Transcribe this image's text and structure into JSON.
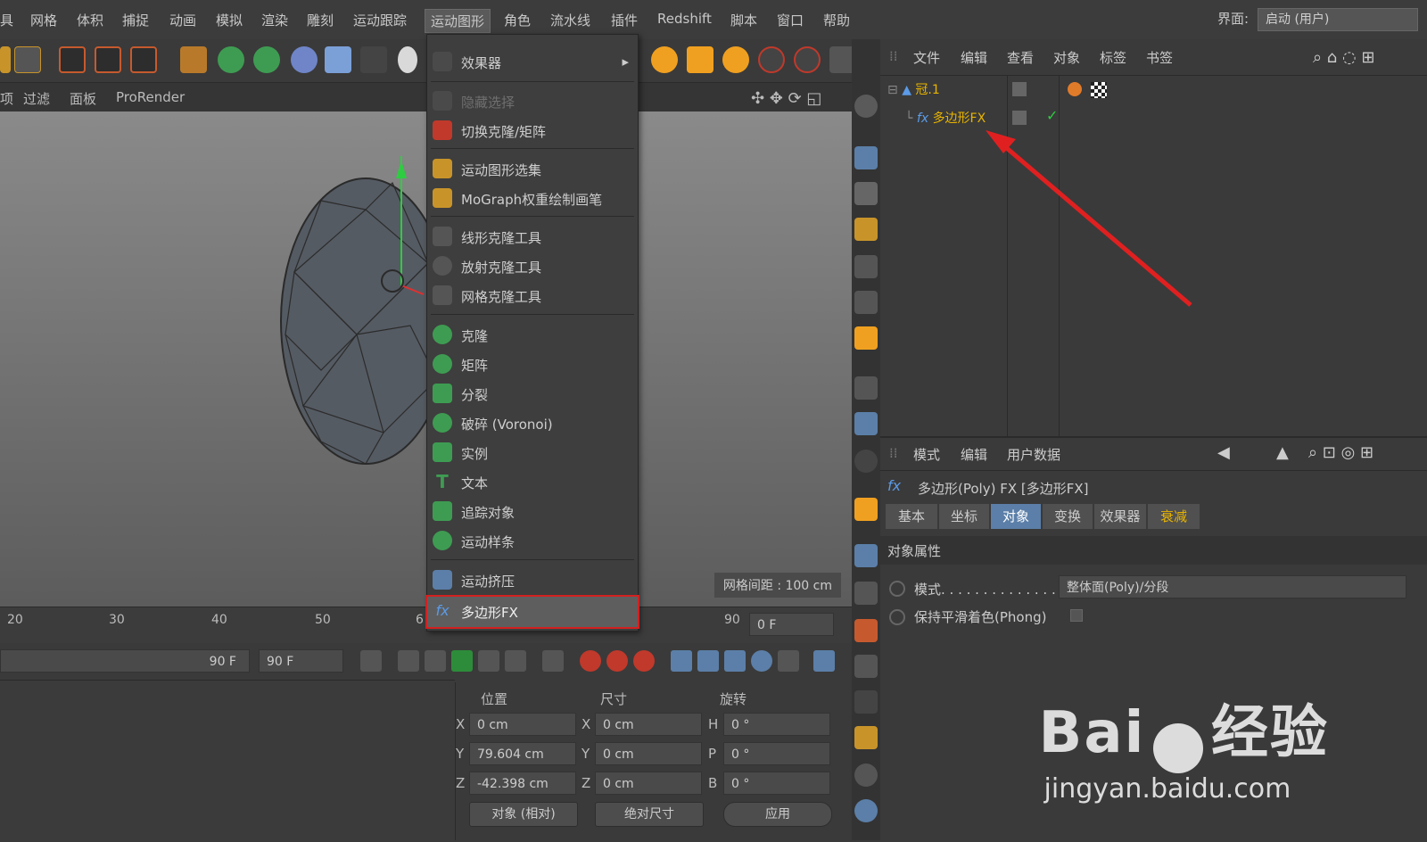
{
  "menubar": {
    "items": [
      "具",
      "网格",
      "体积",
      "捕捉",
      "动画",
      "模拟",
      "渲染",
      "雕刻",
      "运动跟踪",
      "运动图形",
      "角色",
      "流水线",
      "插件",
      "Redshift",
      "脚本",
      "窗口",
      "帮助"
    ],
    "active_index": 9,
    "interface_label": "界面:",
    "interface_value": "启动 (用户)"
  },
  "viewport_bar": {
    "items": [
      "项",
      "过滤",
      "面板",
      "ProRender"
    ]
  },
  "viewport": {
    "grid_spacing": "网格间距 : 100 cm"
  },
  "timeline": {
    "ticks": [
      "20",
      "30",
      "40",
      "50",
      "6",
      "90"
    ],
    "frame_field": "0 F"
  },
  "playbar": {
    "end_frame_slider": "90 F",
    "end_frame_field": "90 F"
  },
  "dropdown": {
    "items": [
      {
        "label": "效果器",
        "has_submenu": true,
        "disabled": false
      },
      {
        "label": "隐藏选择",
        "disabled": true
      },
      {
        "label": "切换克隆/矩阵",
        "disabled": false
      },
      {
        "label": "运动图形选集",
        "disabled": false
      },
      {
        "label": "MoGraph权重绘制画笔",
        "disabled": false
      },
      {
        "label": "线形克隆工具",
        "disabled": false
      },
      {
        "label": "放射克隆工具",
        "disabled": false
      },
      {
        "label": "网格克隆工具",
        "disabled": false
      },
      {
        "label": "克隆",
        "disabled": false
      },
      {
        "label": "矩阵",
        "disabled": false
      },
      {
        "label": "分裂",
        "disabled": false
      },
      {
        "label": "破碎 (Voronoi)",
        "disabled": false
      },
      {
        "label": "实例",
        "disabled": false
      },
      {
        "label": "文本",
        "disabled": false
      },
      {
        "label": "追踪对象",
        "disabled": false
      },
      {
        "label": "运动样条",
        "disabled": false
      },
      {
        "label": "运动挤压",
        "disabled": false
      },
      {
        "label": "多边形FX",
        "disabled": false,
        "highlighted": true
      }
    ]
  },
  "object_manager": {
    "menu": [
      "文件",
      "编辑",
      "查看",
      "对象",
      "标签",
      "书签"
    ],
    "objects": [
      {
        "name": "冠.1"
      },
      {
        "name": "多边形FX"
      }
    ]
  },
  "attributes": {
    "menu": [
      "模式",
      "编辑",
      "用户数据"
    ],
    "title": "多边形(Poly) FX [多边形FX]",
    "tabs": [
      "基本",
      "坐标",
      "对象",
      "变换",
      "效果器",
      "衰减"
    ],
    "active_tab": 2,
    "section": "对象属性",
    "mode_label": "模式. . . . . . . . . . . . . . . . .",
    "mode_value": "整体面(Poly)/分段",
    "phong_label": "保持平滑着色(Phong)"
  },
  "coords": {
    "headers": [
      "位置",
      "尺寸",
      "旋转"
    ],
    "position": {
      "x": "0 cm",
      "y": "79.604 cm",
      "z": "-42.398 cm"
    },
    "size": {
      "x": "0 cm",
      "y": "0 cm",
      "z": "0 cm"
    },
    "rotation": {
      "h": "0 °",
      "p": "0 °",
      "b": "0 °"
    },
    "axis_pos": [
      "X",
      "Y",
      "Z"
    ],
    "axis_size": [
      "X",
      "Y",
      "Z"
    ],
    "axis_rot": [
      "H",
      "P",
      "B"
    ],
    "btn_object": "对象 (相对)",
    "btn_size": "绝对尺寸",
    "btn_apply": "应用"
  },
  "watermark": {
    "brand": "Bai",
    "brand2": "经验",
    "url": "jingyan.baidu.com"
  },
  "colors": {
    "accent": "#5b7fa8",
    "highlight_border": "#d32020",
    "arrow": "#e02020",
    "object_name": "#e8b400"
  }
}
